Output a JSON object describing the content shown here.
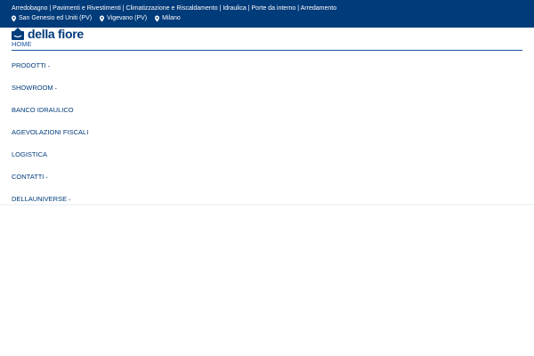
{
  "topbar": {
    "tagline": "Arredobagno | Pavimenti e Rivestimenti | Climatizzazione e Riscaldamento | Idraulica | Porte da interno | Arredamento",
    "locations": [
      {
        "label": "San Genesio ed Uniti (PV)",
        "icon": "map-pin-icon"
      },
      {
        "label": "Vigevano (PV)",
        "icon": "map-pin-icon"
      },
      {
        "label": "Milano",
        "icon": "map-pin-icon"
      }
    ]
  },
  "brand": {
    "name": "della fiore",
    "icon": "della-fiore-logo-icon"
  },
  "nav": {
    "home": "HOME",
    "items": [
      {
        "label": "PRODOTTI",
        "has_submenu": true
      },
      {
        "label": "SHOWROOM",
        "has_submenu": true
      },
      {
        "label": "BANCO IDRAULICO",
        "has_submenu": false
      },
      {
        "label": "AGEVOLAZIONI FISCALI",
        "has_submenu": false
      },
      {
        "label": "LOGISTICA",
        "has_submenu": false
      },
      {
        "label": "CONTATTI",
        "has_submenu": true
      },
      {
        "label": "DELLAUNIVERSE",
        "has_submenu": true
      }
    ],
    "chevron_glyph": "⌄"
  },
  "colors": {
    "primary": "#003b7a",
    "link": "#1a55a3",
    "background": "#ffffff"
  }
}
